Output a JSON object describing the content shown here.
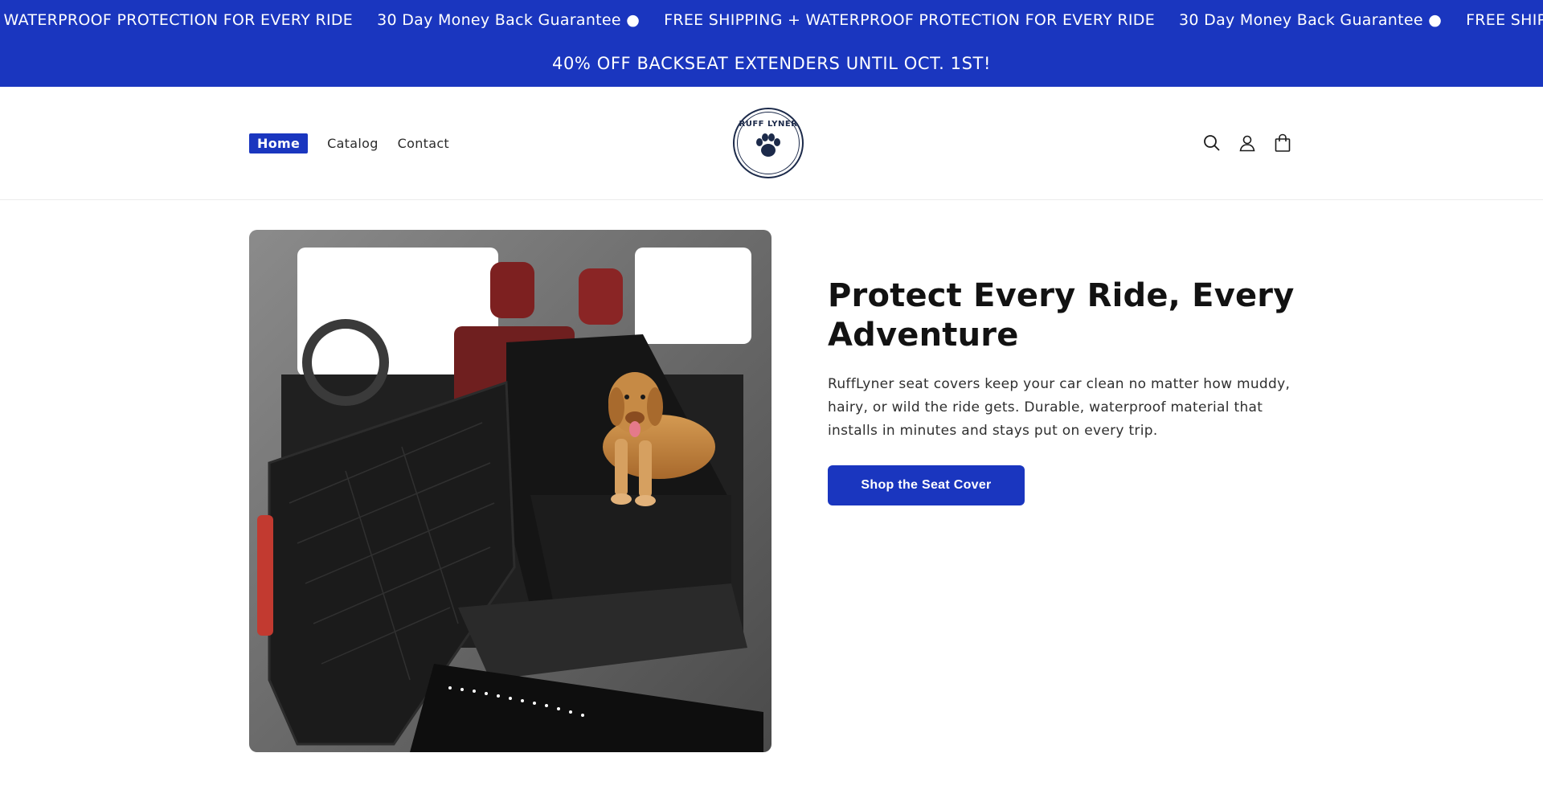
{
  "announcement_marquee": {
    "items": [
      "+ WATERPROOF PROTECTION FOR EVERY RIDE",
      "30 Day Money Back Guarantee ●",
      "FREE SHIPPING + WATERPROOF PROTECTION FOR EVERY RIDE",
      "30 Day Money Back Guarantee ●",
      "FREE SHIPPING + WATERPROOF PROTECTION FOR EVERY RIDE"
    ]
  },
  "promo_bar": {
    "text": "40% OFF BACKSEAT EXTENDERS UNTIL OCT. 1ST!"
  },
  "header": {
    "nav": [
      {
        "label": "Home",
        "active": true
      },
      {
        "label": "Catalog",
        "active": false
      },
      {
        "label": "Contact",
        "active": false
      }
    ],
    "logo": {
      "brand": "RUFF LYNER",
      "icon": "paw-icon"
    },
    "icons": [
      "search-icon",
      "account-icon",
      "cart-icon"
    ]
  },
  "hero": {
    "image_alt": "dog-seat-cover-image",
    "title": "Protect Every Ride, Every Adventure",
    "description": "RuffLyner seat covers keep your car clean no matter how muddy, hairy, or wild the ride gets. Durable, waterproof material that installs in minutes and stays put on every trip.",
    "cta_label": "Shop the Seat Cover"
  },
  "colors": {
    "brand_blue": "#1a36bf",
    "navy": "#1c2a4a",
    "text_dark": "#121212"
  }
}
